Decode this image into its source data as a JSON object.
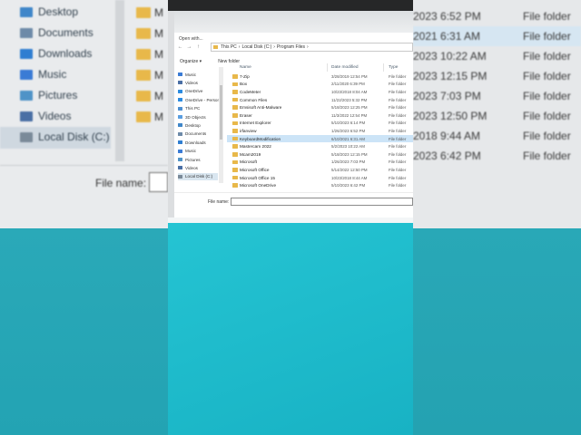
{
  "dialog": {
    "title": "Open with...",
    "address": [
      "This PC",
      "›",
      "Local Disk (C:)",
      "›",
      "Program Files",
      "›"
    ],
    "toolbar": {
      "organize": "Organize ▾",
      "new_folder": "New folder"
    },
    "nav_items": [
      {
        "label": "Music",
        "icon": "music-icon",
        "color": "#3a7bd5"
      },
      {
        "label": "Videos",
        "icon": "video-icon",
        "color": "#4a6fa5"
      },
      {
        "label": "OneDrive",
        "icon": "cloud-icon",
        "color": "#2b8be0"
      },
      {
        "label": "OneDrive - Person",
        "icon": "cloud-icon",
        "color": "#2b8be0"
      },
      {
        "label": "This PC",
        "icon": "computer-icon",
        "color": "#4d8fd1"
      },
      {
        "label": "3D Objects",
        "icon": "cube-icon",
        "color": "#5a9ee0"
      },
      {
        "label": "Desktop",
        "icon": "desktop-icon",
        "color": "#3f86c9"
      },
      {
        "label": "Documents",
        "icon": "document-icon",
        "color": "#6d8aa8"
      },
      {
        "label": "Downloads",
        "icon": "download-icon",
        "color": "#2f7ed1"
      },
      {
        "label": "Music",
        "icon": "music-icon",
        "color": "#3a7bd5"
      },
      {
        "label": "Pictures",
        "icon": "picture-icon",
        "color": "#4f93c7"
      },
      {
        "label": "Videos",
        "icon": "video-icon",
        "color": "#4a6fa5"
      },
      {
        "label": "Local Disk (C:)",
        "icon": "drive-icon",
        "color": "#7a8a99"
      }
    ],
    "columns": {
      "name": "Name",
      "date": "Date modified",
      "type": "Type"
    },
    "files": [
      {
        "name": "7-Zip",
        "date": "3/28/2019 12:54 PM",
        "type": "File folder"
      },
      {
        "name": "Box",
        "date": "2/11/2020 6:39 PM",
        "type": "File folder"
      },
      {
        "name": "CodeMeter",
        "date": "10/23/2018 8:04 AM",
        "type": "File folder"
      },
      {
        "name": "Common Files",
        "date": "11/22/2023 5:32 PM",
        "type": "File folder"
      },
      {
        "name": "Emsisoft Anti-Malware",
        "date": "5/18/2023 12:25 PM",
        "type": "File folder"
      },
      {
        "name": "Eraser",
        "date": "11/3/2022 12:54 PM",
        "type": "File folder"
      },
      {
        "name": "Internet Explorer",
        "date": "5/10/2023 6:14 PM",
        "type": "File folder"
      },
      {
        "name": "irfanview",
        "date": "1/26/2023 6:52 PM",
        "type": "File folder"
      },
      {
        "name": "KeyboardModification",
        "date": "6/10/2021 6:31 AM",
        "type": "File folder"
      },
      {
        "name": "Mastercam 2022",
        "date": "5/2/2023 10:22 AM",
        "type": "File folder"
      },
      {
        "name": "Mcam2019",
        "date": "5/18/2023 12:15 PM",
        "type": "File folder"
      },
      {
        "name": "Microsoft",
        "date": "1/26/2023 7:03 PM",
        "type": "File folder"
      },
      {
        "name": "Microsoft Office",
        "date": "5/14/2022 12:50 PM",
        "type": "File folder"
      },
      {
        "name": "Microsoft Office 15",
        "date": "10/23/2018 8:44 AM",
        "type": "File folder"
      },
      {
        "name": "Microsoft OneDrive",
        "date": "5/10/2023 6:42 PM",
        "type": "File folder"
      }
    ],
    "selected_index": 8,
    "file_name_label": "File name:",
    "file_name_value": ""
  },
  "left_zoom": {
    "nav_items": [
      {
        "label": "Desktop",
        "color": "#3f86c9"
      },
      {
        "label": "Documents",
        "color": "#6d8aa8"
      },
      {
        "label": "Downloads",
        "color": "#2f7ed1"
      },
      {
        "label": "Music",
        "color": "#3a7bd5"
      },
      {
        "label": "Pictures",
        "color": "#4f93c7"
      },
      {
        "label": "Videos",
        "color": "#4a6fa5"
      },
      {
        "label": "Local Disk (C:)",
        "color": "#7a8a99"
      }
    ],
    "folder_letters": [
      "M",
      "M",
      "M",
      "M",
      "M",
      "M"
    ],
    "file_name_label": "File name:"
  },
  "right_zoom": {
    "rows": [
      {
        "date": "2023 6:52 PM",
        "type": "File folder"
      },
      {
        "date": "2021 6:31 AM",
        "type": "File folder"
      },
      {
        "date": "2023 10:22 AM",
        "type": "File folder"
      },
      {
        "date": "2023 12:15 PM",
        "type": "File folder"
      },
      {
        "date": "2023 7:03 PM",
        "type": "File folder"
      },
      {
        "date": "2023 12:50 PM",
        "type": "File folder"
      },
      {
        "date": "2018 9:44 AM",
        "type": "File folder"
      },
      {
        "date": "2023 6:42 PM",
        "type": "File folder"
      }
    ]
  },
  "colors": {
    "folder": "#e8b84a",
    "selection": "#cce4f7",
    "desktop": "#1fbccc"
  }
}
